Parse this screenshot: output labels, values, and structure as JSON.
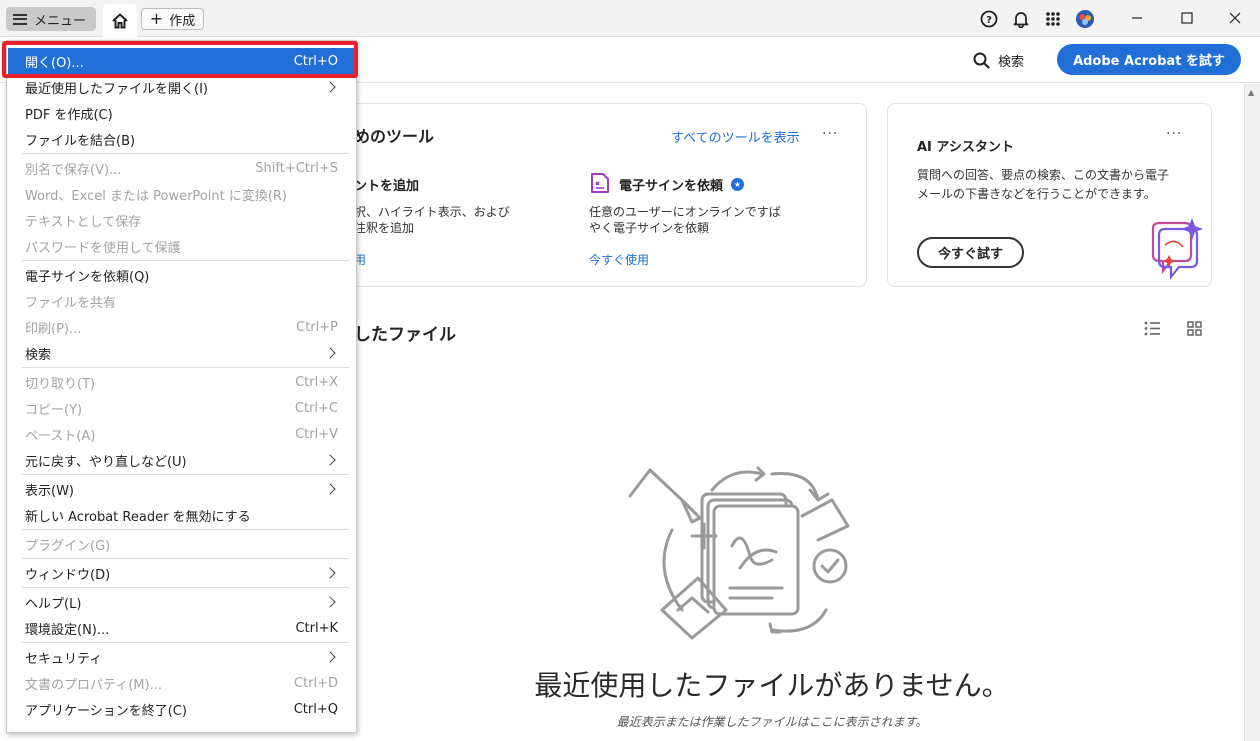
{
  "titlebar": {
    "menu_label": "メニュー",
    "create_label": "作成"
  },
  "appbar": {
    "search_label": "検索",
    "try_button": "Adobe Acrobat を試す"
  },
  "tools_card": {
    "title": "めのツール",
    "view_all": "すべてのツールを表示",
    "more": "···",
    "tool1": {
      "title": "ントを追加",
      "desc_line1": "択、ハイライト表示、および",
      "desc_line2": "注釈を追加",
      "link": "用"
    },
    "tool2": {
      "title": "電子サインを依頼",
      "desc_line1": "任意のユーザーにオンラインですば",
      "desc_line2": "やく電子サインを依頼",
      "link": "今すぐ使用"
    }
  },
  "ai_card": {
    "title": "AI アシスタント",
    "more": "···",
    "desc": "質問への回答、要点の検索、この文書から電子メールの下書きなどを行うことができます。",
    "button": "今すぐ試す"
  },
  "recent": {
    "title": "したファイル",
    "empty_title": "最近使用したファイルがありません。",
    "empty_sub": "最近表示または作業したファイルはここに表示されます。"
  },
  "menu": {
    "items": [
      {
        "label": "開く(O)...",
        "shortcut": "Ctrl+O"
      },
      {
        "label": "最近使用したファイルを開く(I)",
        "shortcut": ""
      },
      {
        "label": "PDF を作成(C)",
        "shortcut": ""
      },
      {
        "label": "ファイルを結合(B)",
        "shortcut": ""
      },
      {
        "label": "別名で保存(V)...",
        "shortcut": "Shift+Ctrl+S"
      },
      {
        "label": "Word、Excel または PowerPoint に変換(R)",
        "shortcut": ""
      },
      {
        "label": "テキストとして保存",
        "shortcut": ""
      },
      {
        "label": "パスワードを使用して保護",
        "shortcut": ""
      },
      {
        "label": "電子サインを依頼(Q)",
        "shortcut": ""
      },
      {
        "label": "ファイルを共有",
        "shortcut": ""
      },
      {
        "label": "印刷(P)...",
        "shortcut": "Ctrl+P"
      },
      {
        "label": "検索",
        "shortcut": ""
      },
      {
        "label": "切り取り(T)",
        "shortcut": "Ctrl+X"
      },
      {
        "label": "コピー(Y)",
        "shortcut": "Ctrl+C"
      },
      {
        "label": "ペースト(A)",
        "shortcut": "Ctrl+V"
      },
      {
        "label": "元に戻す、やり直しなど(U)",
        "shortcut": ""
      },
      {
        "label": "表示(W)",
        "shortcut": ""
      },
      {
        "label": "新しい Acrobat Reader を無効にする",
        "shortcut": ""
      },
      {
        "label": "プラグイン(G)",
        "shortcut": ""
      },
      {
        "label": "ウィンドウ(D)",
        "shortcut": ""
      },
      {
        "label": "ヘルプ(L)",
        "shortcut": ""
      },
      {
        "label": "環境設定(N)...",
        "shortcut": "Ctrl+K"
      },
      {
        "label": "セキュリティ",
        "shortcut": ""
      },
      {
        "label": "文書のプロパティ(M)...",
        "shortcut": "Ctrl+D"
      },
      {
        "label": "アプリケーションを終了(C)",
        "shortcut": "Ctrl+Q"
      }
    ]
  },
  "colors": {
    "accent": "#1f6fd6",
    "highlight": "#e8202a",
    "disabled_text": "#a3a3a3"
  }
}
